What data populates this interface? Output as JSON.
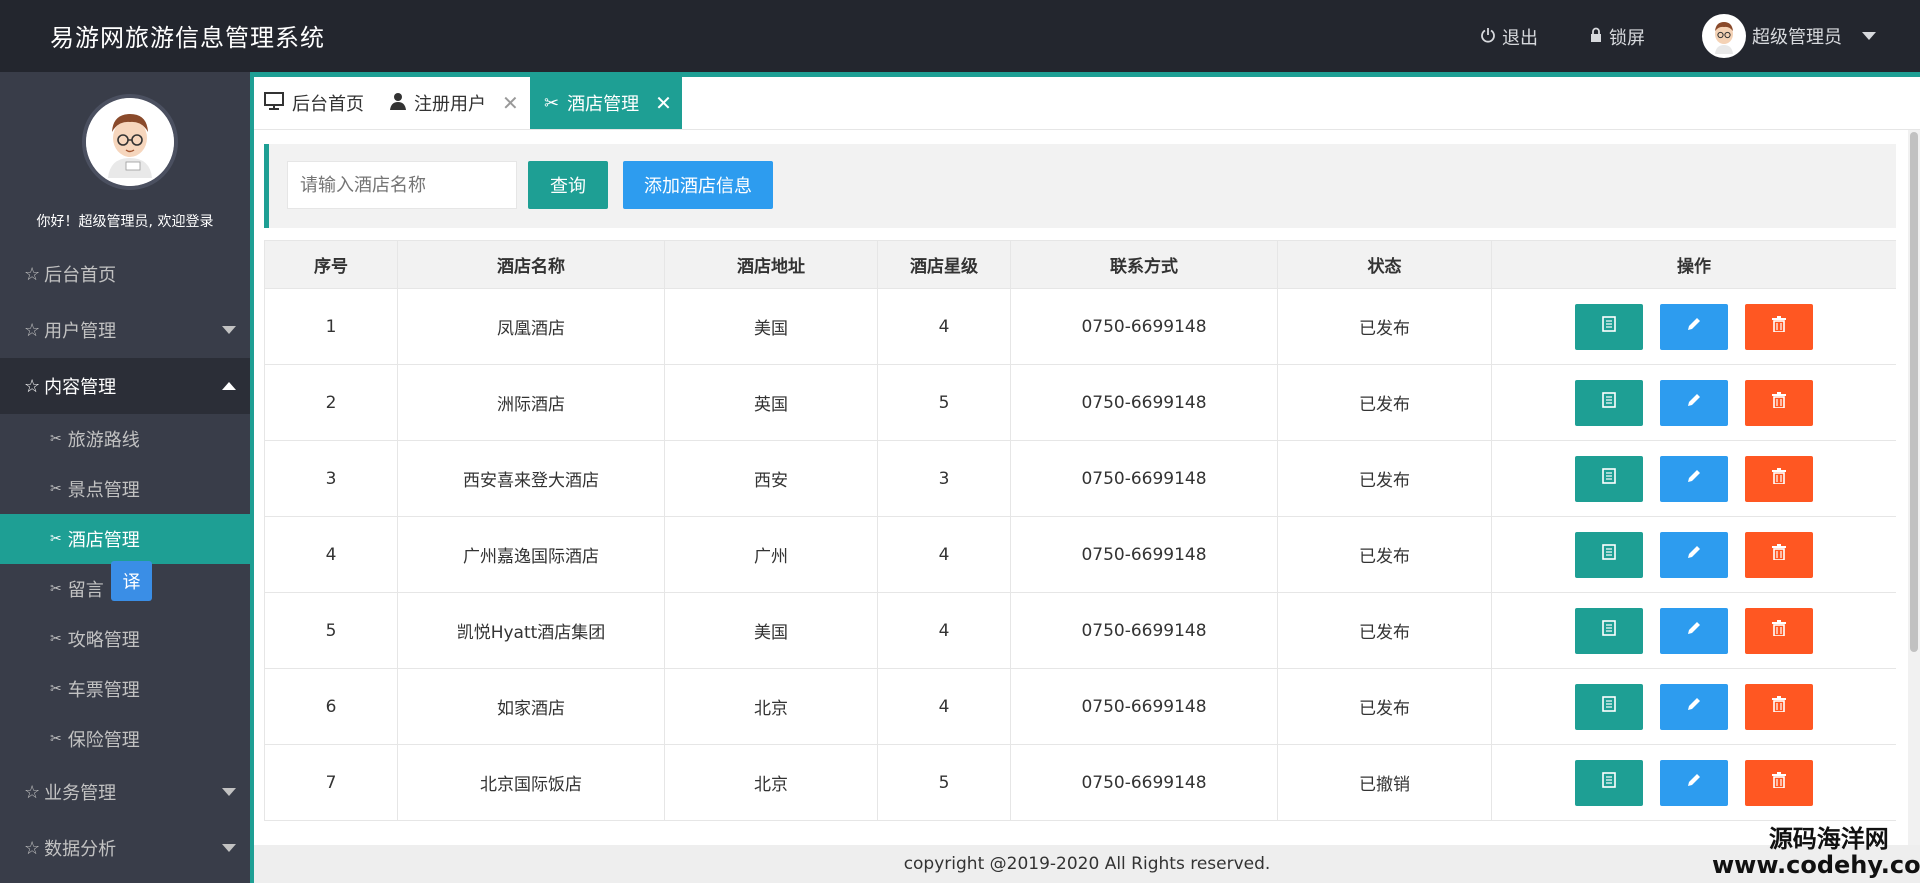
{
  "app": {
    "title": "易游网旅游信息管理系统"
  },
  "header": {
    "logout": "退出",
    "lock": "锁屏",
    "user": "超级管理员"
  },
  "sidebar": {
    "welcome": "你好！超级管理员, 欢迎登录",
    "nav": [
      {
        "label": "后台首页"
      },
      {
        "label": "用户管理"
      },
      {
        "label": "内容管理"
      }
    ],
    "sub": [
      {
        "label": "旅游路线"
      },
      {
        "label": "景点管理"
      },
      {
        "label": "酒店管理"
      },
      {
        "label": "留言"
      },
      {
        "label": "攻略管理"
      },
      {
        "label": "车票管理"
      },
      {
        "label": "保险管理"
      }
    ],
    "nav_bottom": [
      {
        "label": "业务管理"
      },
      {
        "label": "数据分析"
      }
    ],
    "translate_badge": "译"
  },
  "tabs": [
    {
      "label": "后台首页"
    },
    {
      "label": "注册用户"
    },
    {
      "label": "酒店管理"
    }
  ],
  "search": {
    "placeholder": "请输入酒店名称",
    "query_label": "查询",
    "add_label": "添加酒店信息"
  },
  "table": {
    "columns": [
      "序号",
      "酒店名称",
      "酒店地址",
      "酒店星级",
      "联系方式",
      "状态",
      "操作"
    ],
    "rows": [
      [
        "1",
        "凤凰酒店",
        "美国",
        "4",
        "0750-6699148",
        "已发布"
      ],
      [
        "2",
        "洲际酒店",
        "英国",
        "5",
        "0750-6699148",
        "已发布"
      ],
      [
        "3",
        "西安喜来登大酒店",
        "西安",
        "3",
        "0750-6699148",
        "已发布"
      ],
      [
        "4",
        "广州嘉逸国际酒店",
        "广州",
        "4",
        "0750-6699148",
        "已发布"
      ],
      [
        "5",
        "凯悦Hyatt酒店集团",
        "美国",
        "4",
        "0750-6699148",
        "已发布"
      ],
      [
        "6",
        "如家酒店",
        "北京",
        "4",
        "0750-6699148",
        "已发布"
      ],
      [
        "7",
        "北京国际饭店",
        "北京",
        "5",
        "0750-6699148",
        "已撤销"
      ]
    ]
  },
  "footer": {
    "copyright": "copyright @2019-2020 All Rights reserved."
  },
  "watermark": {
    "line1": "源码海洋网",
    "line2": "www.codehy.com"
  }
}
